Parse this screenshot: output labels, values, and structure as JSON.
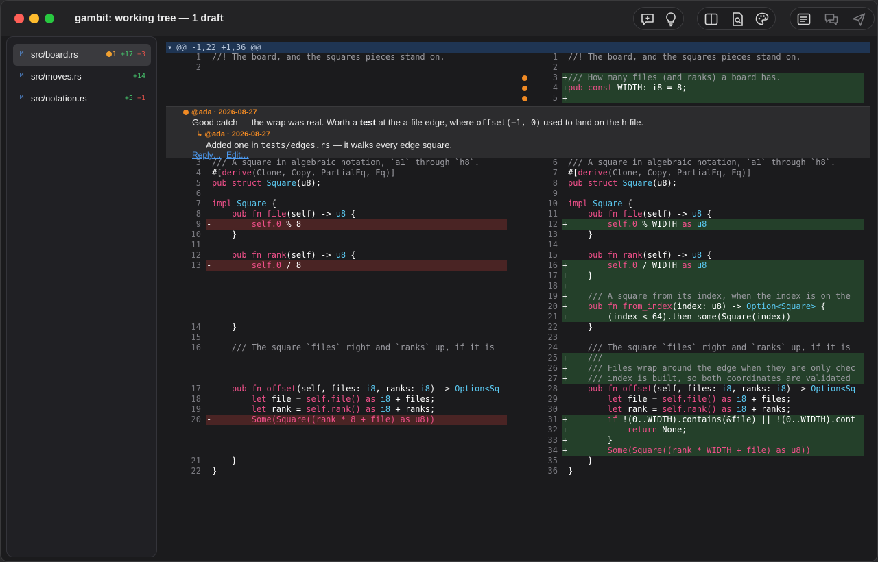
{
  "window": {
    "title": "gambit: working tree — 1 draft",
    "traffic_lights": [
      "#ff5f57",
      "#febc2e",
      "#28c840"
    ]
  },
  "toolbar": {
    "icons": [
      "add-comment-icon",
      "lightbulb-icon",
      "split-view-icon",
      "search-document-icon",
      "palette-icon",
      "list-view-icon",
      "chat-icon",
      "send-icon"
    ]
  },
  "sidebar": {
    "files": [
      {
        "status": "M",
        "name": "src/board.rs",
        "comments": "1",
        "added": "+17",
        "removed": "−3",
        "selected": true
      },
      {
        "status": "M",
        "name": "src/moves.rs",
        "comments": "",
        "added": "+14",
        "removed": "",
        "selected": false
      },
      {
        "status": "M",
        "name": "src/notation.rs",
        "comments": "",
        "added": "+5",
        "removed": "−1",
        "selected": false
      }
    ]
  },
  "diff": {
    "hunk_header": "@@ -1,22 +1,36 @@",
    "left_numbers": [
      "1",
      "2",
      "3",
      "4",
      "5",
      "6",
      "7",
      "8",
      "9",
      "10",
      "11",
      "12",
      "13",
      "14",
      "15",
      "16",
      "17",
      "18",
      "19",
      "20",
      "21",
      "22"
    ],
    "right_numbers": [
      "1",
      "2",
      "3",
      "4",
      "5",
      "6",
      "7",
      "8",
      "9",
      "10",
      "11",
      "12",
      "13",
      "14",
      "15",
      "16",
      "17",
      "18",
      "19",
      "20",
      "21",
      "22",
      "23",
      "24",
      "25",
      "26",
      "27",
      "28",
      "29",
      "30",
      "31",
      "32",
      "33",
      "34",
      "35",
      "36"
    ]
  },
  "thread": {
    "comment": {
      "author": "@ada · 2026-08-27",
      "text_before": "Good catch — the wrap was real. Worth a ",
      "text_bold": "test",
      "text_mid": " at the a-file edge, where ",
      "text_code": "offset(−1, 0)",
      "text_after": " used to land on the h-file."
    },
    "reply": {
      "author": "↳ @ada · 2026-08-27",
      "text_before": "Added one in ",
      "text_code": "tests/edges.rs",
      "text_after": " — it walks every edge square."
    },
    "actions": {
      "reply": "Reply…",
      "edit": "Edit…"
    }
  },
  "code": {
    "l1": "//! The board, and the squares pieces stand on.",
    "l3": "/// A square in algebraic notation, `a1` through `h8`.",
    "derive_attr": "#[",
    "derive_kw": "derive",
    "derive_args": "(Clone, Copy, PartialEq, Eq)]",
    "pub": "pub",
    "struct": "struct",
    "square": "Square",
    "u8": "u8",
    "u8_paren": "(u8);",
    "impl": "impl",
    "brace_open": " {",
    "brace_close": "}",
    "fn": "fn",
    "file_fn": "file",
    "rank_fn": "rank",
    "self_arg": "(self) ->",
    "self0": "self.0",
    "mod8": " % 8",
    "div8": " / 8",
    "mod_width": " % WIDTH ",
    "div_width": " / WIDTH ",
    "as": "as",
    "offset_comment": "/// The square `files` right and `ranks` up, if it is",
    "offset_fn": "offset",
    "offset_sig_a": "(self, files: ",
    "i8": "i8",
    "offset_sig_b": ", ranks: ",
    "offset_sig_c": ") -> ",
    "option_sq": "Option<Sq",
    "let": "let",
    "let_file": " file = ",
    "let_rank": " rank = ",
    "self_file": "self.file()",
    "self_rank": "self.rank()",
    "plus_files": " + files;",
    "plus_ranks": " + ranks;",
    "some_sq_old": "Some(Square((rank * 8 + file) as u8))",
    "const_doc": "/// How many files (and ranks) a board has.",
    "const_kw": "const",
    "const_rest": " WIDTH: i8 = 8;",
    "from_index_doc": "/// A square from its index, when the index is on the",
    "from_index_fn": "from_index",
    "from_index_sig": "(index: u8) -> ",
    "option_square": "Option<Square>",
    "from_index_body": "(index < 64).then_some(Square(index))",
    "doc_empty": "///",
    "doc_wrap1": "/// Files wrap around the edge when they are only chec",
    "doc_wrap2": "/// index is built, so both coordinates are validated",
    "if_kw": "if",
    "if_body": " !(0..WIDTH).contains(&file) || !(0..WIDTH).cont",
    "return_kw": "return",
    "return_none": " None;",
    "some_sq_new": "Some(Square((rank * WIDTH + file) as u8))"
  }
}
